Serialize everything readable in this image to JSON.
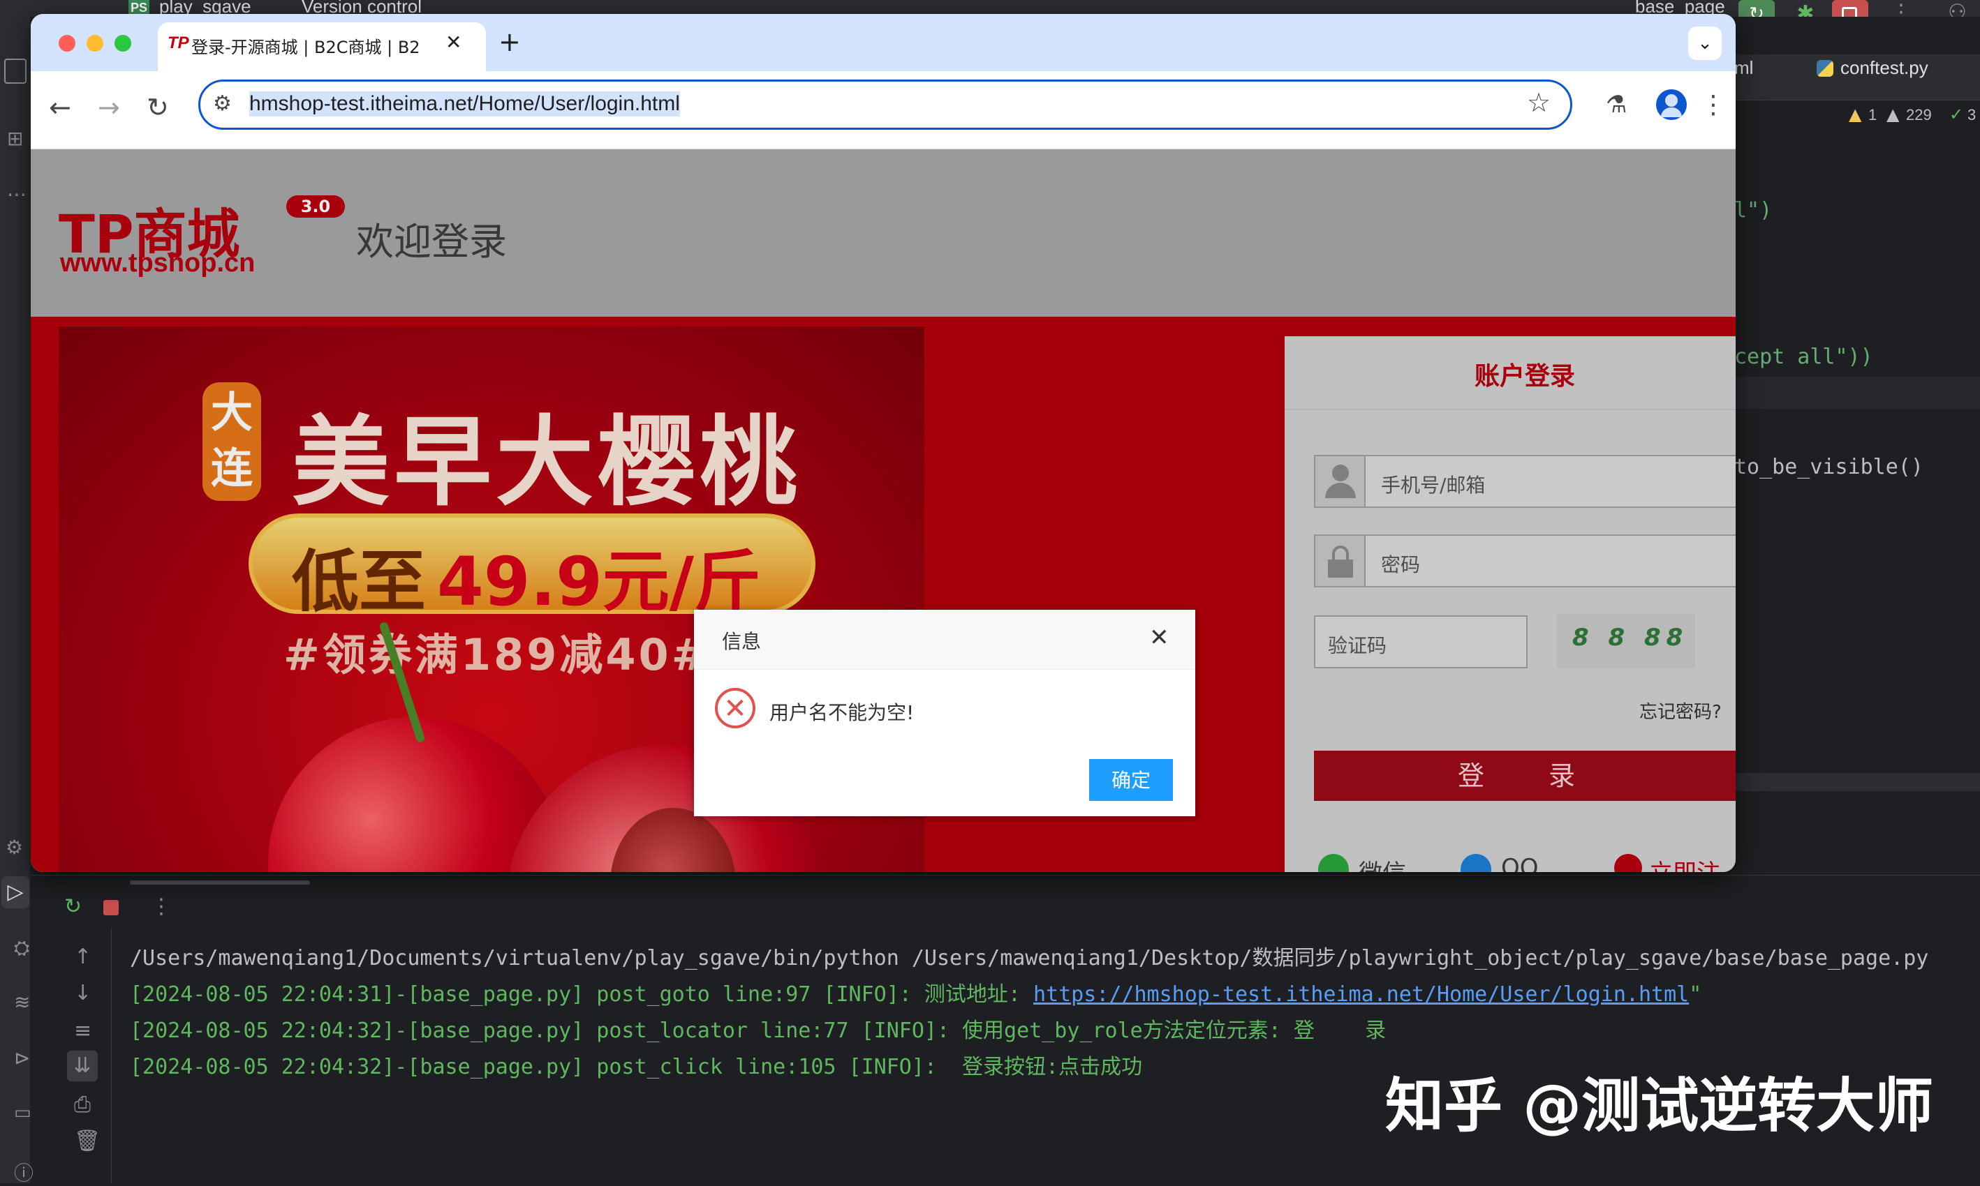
{
  "ide": {
    "project_name": "play_sgave",
    "version_control": "Version control",
    "branch_widget": "base_page",
    "editor_tab_partial": "ml",
    "editor_tab": "conftest.py",
    "warnings": [
      "1",
      "229",
      "3"
    ],
    "code_fragments": [
      "l\")",
      "cept all\"))",
      "to_be_visible()"
    ]
  },
  "browser": {
    "tab_favicon": "TP",
    "tab_title": "登录-开源商城 | B2C商城 | B2",
    "url": "hmshop-test.itheima.net/Home/User/login.html"
  },
  "page": {
    "logo_main": "TP商城",
    "logo_version": "3.0",
    "logo_url": "www.tpshop.cn",
    "welcome": "欢迎登录",
    "banner": {
      "badge": "大连",
      "headline": "美早大樱桃",
      "price_prefix": "低至",
      "price": "49.9元/斤",
      "coupon": "#领券满189减40#"
    },
    "login": {
      "title": "账户登录",
      "username_placeholder": "手机号/邮箱",
      "password_placeholder": "密码",
      "captcha_placeholder": "验证码",
      "captcha_text": "8 8 88",
      "forgot": "忘记密码?",
      "submit": "登 录",
      "social": [
        "微信",
        "QQ",
        "立即注册"
      ]
    },
    "dialog": {
      "title": "信息",
      "message": "用户名不能为空!",
      "ok": "确定"
    }
  },
  "console": {
    "lines": [
      {
        "prefix": "/Users/mawenqiang1/Documents/virtualenv/play_sgave/bin/python /Users/mawenqiang1/Desktop/数据同步/playwright_object/play_sgave/base/base_page.py",
        "link": "",
        "suffix": ""
      },
      {
        "prefix": "[2024-08-05 22:04:31]-[base_page.py] post_goto line:97 [INFO]: 测试地址: ",
        "link": "https://hmshop-test.itheima.net/Home/User/login.html",
        "suffix": "\""
      },
      {
        "prefix": "[2024-08-05 22:04:32]-[base_page.py] post_locator line:77 [INFO]: 使用get_by_role方法定位元素: 登    录",
        "link": "",
        "suffix": ""
      },
      {
        "prefix": "[2024-08-05 22:04:32]-[base_page.py] post_click line:105 [INFO]:  登录按钮:点击成功",
        "link": "",
        "suffix": ""
      }
    ]
  },
  "watermark": "知乎 @测试逆转大师",
  "colors": {
    "accent": "#0b57d0",
    "dialog_button": "#1e9fff",
    "brand_red": "#c40010",
    "console_info": "#5fb85f"
  }
}
